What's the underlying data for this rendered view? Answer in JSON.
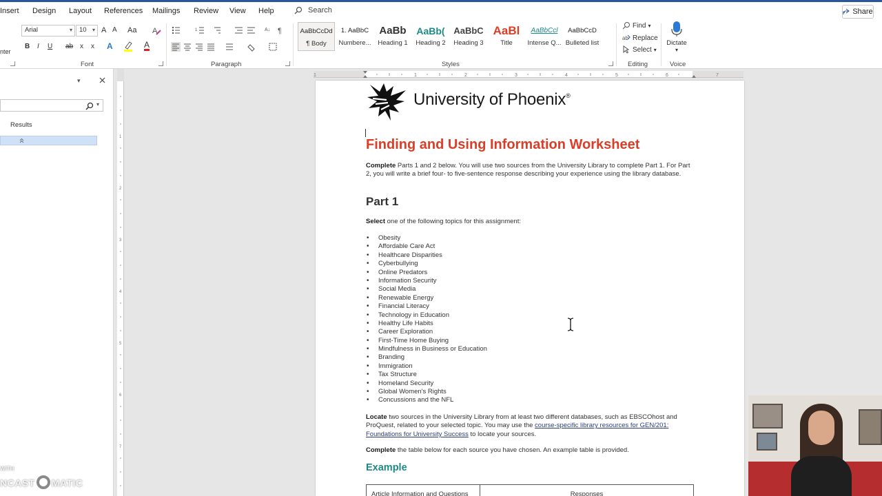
{
  "ribbon_tabs": [
    "Insert",
    "Design",
    "Layout",
    "References",
    "Mailings",
    "Review",
    "View",
    "Help"
  ],
  "search": {
    "label": "Search"
  },
  "share": {
    "label": "Share"
  },
  "font": {
    "name": "Arial",
    "size": "10",
    "group_label": "Font",
    "grow_label": "A",
    "shrink_label": "A",
    "case_label": "Aa",
    "bold": "B",
    "italic": "I",
    "underline": "U",
    "strikethrough": "ab",
    "subscript": "x",
    "superscript": "x",
    "text_effects": "A",
    "font_color": "A"
  },
  "paragraph": {
    "group_label": "Paragraph"
  },
  "styles": {
    "group_label": "Styles",
    "items": [
      {
        "sample": "AaBbCcDd",
        "name": "¶ Body"
      },
      {
        "sample": "1. AaBbC",
        "name": "Numbere..."
      },
      {
        "sample": "AaBb",
        "name": "Heading 1"
      },
      {
        "sample": "AaBb(",
        "name": "Heading 2"
      },
      {
        "sample": "AaBbC",
        "name": "Heading 3"
      },
      {
        "sample": "AaBl",
        "name": "Title"
      },
      {
        "sample": "AaBbCcl",
        "name": "Intense Q..."
      },
      {
        "sample": "AaBbCcD",
        "name": "Bulleted list"
      }
    ]
  },
  "editing": {
    "group_label": "Editing",
    "find": "Find",
    "replace": "Replace",
    "select": "Select"
  },
  "voice": {
    "group_label": "Voice",
    "dictate": "Dictate"
  },
  "nav_pane": {
    "partial_label": "nter",
    "results_tab": "Results"
  },
  "document": {
    "logo_text": "University of Phoenix",
    "logo_reg": "®",
    "title": "Finding and Using Information Worksheet",
    "intro": {
      "bold": "Complete",
      "text": " Parts 1 and 2 below. You will use two sources from the University Library to complete Part 1. For Part 2, you will write a brief four- to five-sentence response describing your experience using the library database."
    },
    "part1_heading": "Part 1",
    "select_line": {
      "bold": "Select",
      "text": " one of the following topics for this assignment:"
    },
    "topics": [
      "Obesity",
      "Affordable Care Act",
      "Healthcare Disparities",
      "Cyberbullying",
      "Online Predators",
      "Information Security",
      "Social Media",
      "Renewable Energy",
      "Financial Literacy",
      "Technology in Education",
      "Healthy Life Habits",
      "Career Exploration",
      "First-Time Home Buying",
      "Mindfulness in Business or Education",
      "Branding",
      "Immigration",
      "Tax Structure",
      "Homeland Security",
      "Global Women's Rights",
      "Concussions and the NFL"
    ],
    "locate": {
      "bold": "Locate",
      "text1": " two sources in the University Library from at least two different databases, such as EBSCOhost and ProQuest, related to your selected topic. You may use the ",
      "link": "course-specific library resources for GEN/201: Foundations for University Success",
      "text2": " to locate your sources."
    },
    "complete_table": {
      "bold": "Complete",
      "text": " the table below for each source you have chosen. An example table is provided."
    },
    "example_heading": "Example",
    "table_headers": [
      "Article Information and Questions",
      "Responses"
    ]
  },
  "watermark": {
    "small": "WITH",
    "big_left": "NCAST",
    "big_right": "MATIC"
  },
  "colors": {
    "accent": "#2b579a",
    "title_red": "#db3d26",
    "example_teal": "#1b8a87",
    "nav_highlight": "#cfe0f7"
  }
}
